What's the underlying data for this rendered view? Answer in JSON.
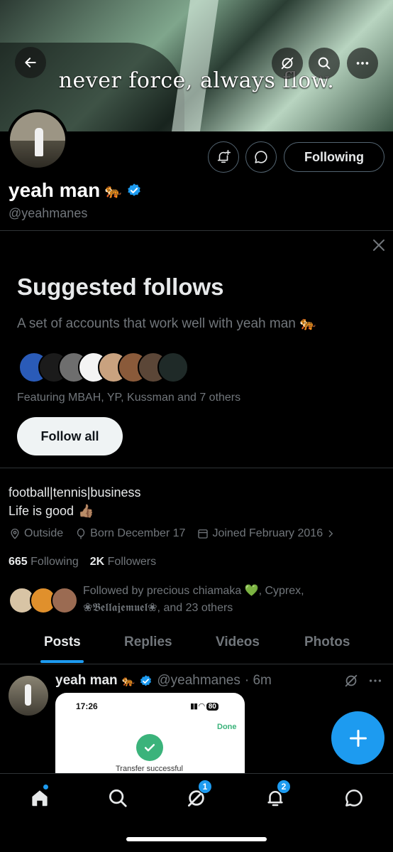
{
  "banner": {
    "caption": "never force, always flow."
  },
  "profile": {
    "name": "yeah man",
    "name_emoji": "🐅",
    "handle": "@yeahmanes",
    "following_button": "Following"
  },
  "suggested": {
    "title": "Suggested follows",
    "subtitle": "A set of accounts that work well with yeah man",
    "subtitle_emoji": "🐅",
    "featuring": "Featuring MBAH, YP, Kussman and 7 others",
    "follow_all_label": "Follow all"
  },
  "bio": {
    "line1": "football|tennis|business",
    "line2": "Life is good",
    "line2_emoji": "👍🏽",
    "location": "Outside",
    "born": "Born December 17",
    "joined": "Joined February 2016"
  },
  "stats": {
    "following_count": "665",
    "following_label": "Following",
    "followers_count": "2K",
    "followers_label": "Followers"
  },
  "followed_by": {
    "text_line1": "Followed by precious chiamaka 💚, Cyprex,",
    "text_line2": "❀𝕭𝖊𝖑𝖑𝖆𝖏𝖊𝖒𝖚𝖊𝖑❀, and 23 others"
  },
  "tabs": [
    {
      "label": "Posts",
      "active": true
    },
    {
      "label": "Replies",
      "active": false
    },
    {
      "label": "Videos",
      "active": false
    },
    {
      "label": "Photos",
      "active": false
    }
  ],
  "post": {
    "name": "yeah man",
    "emoji": "🐅",
    "handle": "@yeahmanes",
    "time": "· 6m",
    "image": {
      "status_time": "17:26",
      "battery": "80",
      "done_label": "Done",
      "caption": "Transfer successful"
    }
  },
  "nav": {
    "grok_badge": "1",
    "notifications_badge": "2"
  },
  "colors": {
    "accent": "#1d9bf0",
    "muted": "#71767b",
    "background": "#000000",
    "success": "#3bb37b"
  }
}
